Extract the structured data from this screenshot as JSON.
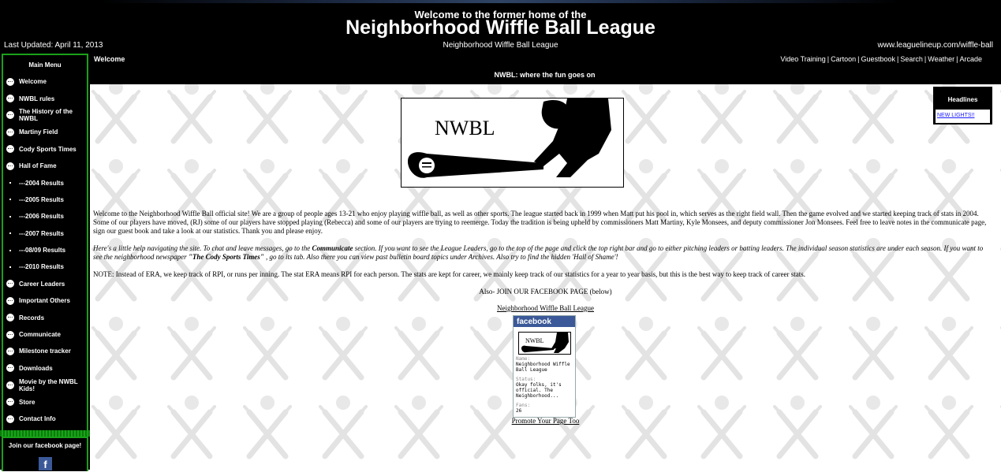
{
  "header": {
    "pre_title": "Welcome to the former home of the",
    "title": "Neighborhood Wiffle Ball League",
    "subtitle": "Neighborhood Wiffle Ball League",
    "last_updated": "Last Updated: April 11, 2013",
    "url": "www.leaguelineup.com/wiffle-ball",
    "welcome": "Welcome",
    "tagline": "NWBL: where the fun goes on",
    "nav": [
      "Video Training",
      "Cartoon",
      "Guestbook",
      "Search",
      "Weather",
      "Arcade"
    ]
  },
  "sidebar": {
    "menu_title": "Main Menu",
    "items": [
      {
        "label": "Welcome",
        "kind": "ball"
      },
      {
        "label": "NWBL rules",
        "kind": "ball"
      },
      {
        "label": "The History of the NWBL",
        "kind": "ball"
      },
      {
        "label": "Martiny Field",
        "kind": "ball"
      },
      {
        "label": "Cody Sports Times",
        "kind": "ball"
      },
      {
        "label": "Hall of Fame",
        "kind": "ball"
      },
      {
        "label": "---2004 Results",
        "kind": "dot"
      },
      {
        "label": "---2005 Results",
        "kind": "dot"
      },
      {
        "label": "---2006 Results",
        "kind": "dot"
      },
      {
        "label": "---2007 Results",
        "kind": "dot"
      },
      {
        "label": "---08/09 Results",
        "kind": "dot"
      },
      {
        "label": "---2010 Results",
        "kind": "dot"
      },
      {
        "label": "Career Leaders",
        "kind": "ball"
      },
      {
        "label": "Important Others",
        "kind": "ball"
      },
      {
        "label": "Records",
        "kind": "ball"
      },
      {
        "label": "Communicate",
        "kind": "ball"
      },
      {
        "label": "Milestone tracker",
        "kind": "ball"
      },
      {
        "label": "Downloads",
        "kind": "ball"
      },
      {
        "label": "Movie by the NWBL Kids!",
        "kind": "ball"
      },
      {
        "label": "Store",
        "kind": "ball"
      },
      {
        "label": "Contact Info",
        "kind": "ball"
      }
    ],
    "facebook_title": "Join our facebook page!",
    "facebook_icon": "f"
  },
  "headlines": {
    "title": "Headlines",
    "link": "NEW LIGHTS!!"
  },
  "logo": {
    "text": "NWBL"
  },
  "content": {
    "p1": "Welcome to the Neighborhood Wiffle Ball official site! We are a group of people ages 13-21 who enjoy playing wiffle ball, as well as other sports. The league started back in 1999 when Matt put his pool in, which serves as the right field wall. Then the game evolved and we started keeping track of stats in 2004. Some of our players have moved, (RJ) some of our players have stopped playing (Rebecca) and some of our players are trying to reemerge. Today the tradition is being upheld by commissioners Matt Martiny, Kyle Monsees, and deputy commissioner Jon Monsees. Feel free to leave notes in the communicate page, sign our guest book and take a look at our statistics. Thank you and please enjoy.",
    "p2_a": "Here's a little help navigating the site. To chat and leave messages, go to the ",
    "p2_b": "Communicate",
    "p2_c": " section. If you want to see the League Leaders, go to the top of the page and click the top right bar and go to either pitching leaders or batting leaders. The individual season statistics are under each season. If you want to see the neighborhood newspaper ",
    "p2_d": "\"The Cody Sports Times\"",
    "p2_e": " , go to its tab. Also there you can view past bulletin board topics under Archives. Also try to find the hidden 'Hall of Shame'!",
    "p3": "NOTE: Instead of ERA, we keep track of RPI, or runs per inning. The stat ERA means RPI for each person. The stats are kept for career, we mainly keep track of our statistics for a year to year basis, but this is the best way to keep track of career stats.",
    "facebook_line": "Also- JOIN OUR FACEBOOK PAGE (below)",
    "page_link": "Neighborhood Wiffle Ball League",
    "promote": "Promote Your Page Too"
  },
  "fb_badge": {
    "header": "facebook",
    "thumb_text": "NWBL",
    "name_label": "Name:",
    "name_value": "Neighborhood Wiffle Ball League",
    "status_label": "Status:",
    "status_value": "Okay folks, it's official. The Neighborhood...",
    "fans_label": "Fans:",
    "fans_value": "26"
  },
  "colors": {
    "header_bg": "#000000",
    "sidebar_border": "#1aa01a",
    "facebook_blue": "#3b5998",
    "link_blue": "#1a1aff"
  }
}
